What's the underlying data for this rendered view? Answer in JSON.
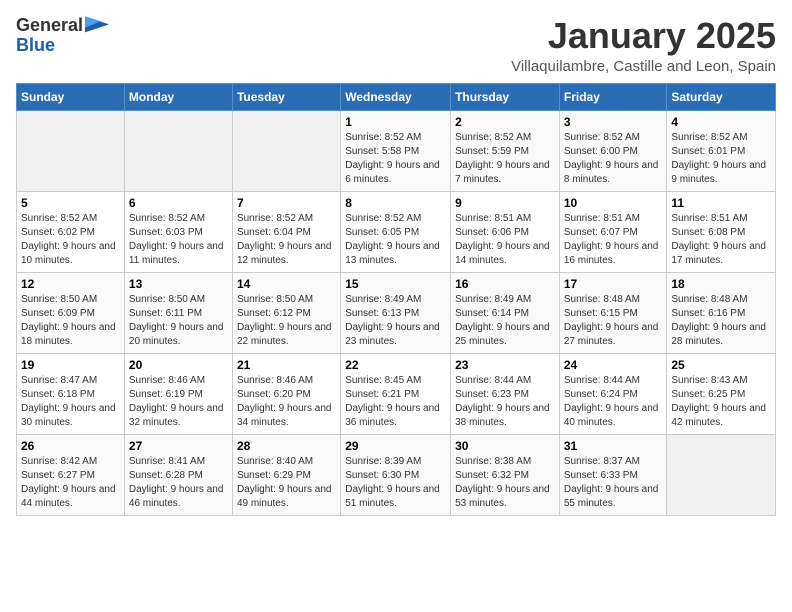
{
  "header": {
    "logo_general": "General",
    "logo_blue": "Blue",
    "title": "January 2025",
    "subtitle": "Villaquilambre, Castille and Leon, Spain"
  },
  "weekdays": [
    "Sunday",
    "Monday",
    "Tuesday",
    "Wednesday",
    "Thursday",
    "Friday",
    "Saturday"
  ],
  "weeks": [
    [
      {
        "day": "",
        "info": ""
      },
      {
        "day": "",
        "info": ""
      },
      {
        "day": "",
        "info": ""
      },
      {
        "day": "1",
        "info": "Sunrise: 8:52 AM\nSunset: 5:58 PM\nDaylight: 9 hours and 6 minutes."
      },
      {
        "day": "2",
        "info": "Sunrise: 8:52 AM\nSunset: 5:59 PM\nDaylight: 9 hours and 7 minutes."
      },
      {
        "day": "3",
        "info": "Sunrise: 8:52 AM\nSunset: 6:00 PM\nDaylight: 9 hours and 8 minutes."
      },
      {
        "day": "4",
        "info": "Sunrise: 8:52 AM\nSunset: 6:01 PM\nDaylight: 9 hours and 9 minutes."
      }
    ],
    [
      {
        "day": "5",
        "info": "Sunrise: 8:52 AM\nSunset: 6:02 PM\nDaylight: 9 hours and 10 minutes."
      },
      {
        "day": "6",
        "info": "Sunrise: 8:52 AM\nSunset: 6:03 PM\nDaylight: 9 hours and 11 minutes."
      },
      {
        "day": "7",
        "info": "Sunrise: 8:52 AM\nSunset: 6:04 PM\nDaylight: 9 hours and 12 minutes."
      },
      {
        "day": "8",
        "info": "Sunrise: 8:52 AM\nSunset: 6:05 PM\nDaylight: 9 hours and 13 minutes."
      },
      {
        "day": "9",
        "info": "Sunrise: 8:51 AM\nSunset: 6:06 PM\nDaylight: 9 hours and 14 minutes."
      },
      {
        "day": "10",
        "info": "Sunrise: 8:51 AM\nSunset: 6:07 PM\nDaylight: 9 hours and 16 minutes."
      },
      {
        "day": "11",
        "info": "Sunrise: 8:51 AM\nSunset: 6:08 PM\nDaylight: 9 hours and 17 minutes."
      }
    ],
    [
      {
        "day": "12",
        "info": "Sunrise: 8:50 AM\nSunset: 6:09 PM\nDaylight: 9 hours and 18 minutes."
      },
      {
        "day": "13",
        "info": "Sunrise: 8:50 AM\nSunset: 6:11 PM\nDaylight: 9 hours and 20 minutes."
      },
      {
        "day": "14",
        "info": "Sunrise: 8:50 AM\nSunset: 6:12 PM\nDaylight: 9 hours and 22 minutes."
      },
      {
        "day": "15",
        "info": "Sunrise: 8:49 AM\nSunset: 6:13 PM\nDaylight: 9 hours and 23 minutes."
      },
      {
        "day": "16",
        "info": "Sunrise: 8:49 AM\nSunset: 6:14 PM\nDaylight: 9 hours and 25 minutes."
      },
      {
        "day": "17",
        "info": "Sunrise: 8:48 AM\nSunset: 6:15 PM\nDaylight: 9 hours and 27 minutes."
      },
      {
        "day": "18",
        "info": "Sunrise: 8:48 AM\nSunset: 6:16 PM\nDaylight: 9 hours and 28 minutes."
      }
    ],
    [
      {
        "day": "19",
        "info": "Sunrise: 8:47 AM\nSunset: 6:18 PM\nDaylight: 9 hours and 30 minutes."
      },
      {
        "day": "20",
        "info": "Sunrise: 8:46 AM\nSunset: 6:19 PM\nDaylight: 9 hours and 32 minutes."
      },
      {
        "day": "21",
        "info": "Sunrise: 8:46 AM\nSunset: 6:20 PM\nDaylight: 9 hours and 34 minutes."
      },
      {
        "day": "22",
        "info": "Sunrise: 8:45 AM\nSunset: 6:21 PM\nDaylight: 9 hours and 36 minutes."
      },
      {
        "day": "23",
        "info": "Sunrise: 8:44 AM\nSunset: 6:23 PM\nDaylight: 9 hours and 38 minutes."
      },
      {
        "day": "24",
        "info": "Sunrise: 8:44 AM\nSunset: 6:24 PM\nDaylight: 9 hours and 40 minutes."
      },
      {
        "day": "25",
        "info": "Sunrise: 8:43 AM\nSunset: 6:25 PM\nDaylight: 9 hours and 42 minutes."
      }
    ],
    [
      {
        "day": "26",
        "info": "Sunrise: 8:42 AM\nSunset: 6:27 PM\nDaylight: 9 hours and 44 minutes."
      },
      {
        "day": "27",
        "info": "Sunrise: 8:41 AM\nSunset: 6:28 PM\nDaylight: 9 hours and 46 minutes."
      },
      {
        "day": "28",
        "info": "Sunrise: 8:40 AM\nSunset: 6:29 PM\nDaylight: 9 hours and 49 minutes."
      },
      {
        "day": "29",
        "info": "Sunrise: 8:39 AM\nSunset: 6:30 PM\nDaylight: 9 hours and 51 minutes."
      },
      {
        "day": "30",
        "info": "Sunrise: 8:38 AM\nSunset: 6:32 PM\nDaylight: 9 hours and 53 minutes."
      },
      {
        "day": "31",
        "info": "Sunrise: 8:37 AM\nSunset: 6:33 PM\nDaylight: 9 hours and 55 minutes."
      },
      {
        "day": "",
        "info": ""
      }
    ]
  ]
}
